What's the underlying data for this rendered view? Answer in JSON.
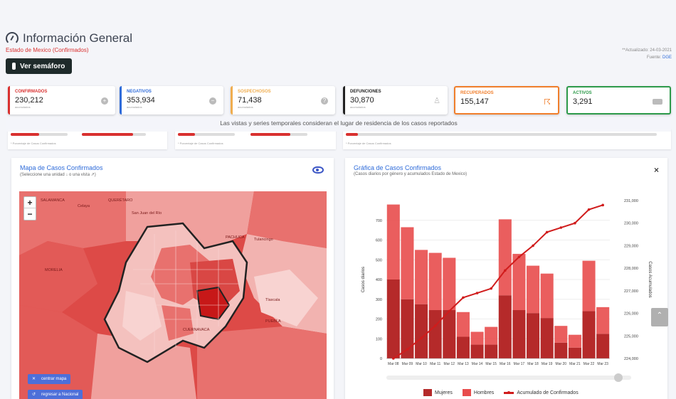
{
  "header": {
    "title": "Información General",
    "subtitle": "Estado de Mexico (Confirmados)",
    "semaforo_button": "Ver semáforo",
    "updated": "**Actualizado: 24-03-2021",
    "source_label": "Fuente:",
    "source": "DGE"
  },
  "cards": [
    {
      "label": "Confirmados",
      "value": "230,212",
      "sub": "acumulados",
      "color": "#d9302f",
      "icon": "plus-circle-icon"
    },
    {
      "label": "Negativos",
      "value": "353,934",
      "sub": "acumulados",
      "color": "#2e6bd9",
      "icon": "minus-circle-icon"
    },
    {
      "label": "Sospechosos",
      "value": "71,438",
      "sub": "acumulados",
      "color": "#f0ad4e",
      "icon": "question-circle-icon"
    },
    {
      "label": "Defunciones",
      "value": "30,870",
      "sub": "acumulados",
      "color": "#222222",
      "icon": "person-icon"
    },
    {
      "label": "Recuperados",
      "value": "155,147",
      "sub": "",
      "color": "#f07e2b",
      "icon": "walking-icon"
    },
    {
      "label": "Activos",
      "value": "3,291",
      "sub": "",
      "color": "#2d9a4a",
      "icon": "bed-icon"
    }
  ],
  "note": "Las vistas y series temporales consideran el lugar de residencia de los casos reportados",
  "strips": {
    "foot1": "* Porcentaje de Casos Confirmados",
    "foot2": "* Porcentaje de Casos Confirmados",
    "foot3": "* Porcentaje de Casos Confirmados"
  },
  "map_panel": {
    "title": "Mapa de Casos Confirmados",
    "subtitle": "(Seleccione una unidad ↓ o una vista ↗)",
    "zoom_in": "+",
    "zoom_out": "−",
    "btn_center": "centrar mapa",
    "btn_national": "regresar a Nacional",
    "labels": {
      "salamanca": "SALAMANCA",
      "queretaro": "QUERÉTARO",
      "celaya": "Celaya",
      "sanjuan": "San Juan del Río",
      "pachuca": "PACHUCA",
      "tulancingo": "Tulancingo",
      "morelia": "MORELIA",
      "tlaxcala": "Tlaxcala",
      "puebla": "PUEBLA",
      "cuernavaca": "CUERNAVACA"
    }
  },
  "chart_panel": {
    "title": "Gráfica de Casos Confirmados",
    "subtitle": "(Casos diarios por género y acumulados Estado de Mexico)",
    "close": "×",
    "legend": {
      "women": "Mujeres",
      "men": "Hombres",
      "cum": "Acumulado de Confirmados"
    }
  },
  "chart_data": {
    "type": "bar",
    "categories": [
      "Mar 08",
      "Mar 09",
      "Mar 10",
      "Mar 11",
      "Mar 12",
      "Mar 13",
      "Mar 14",
      "Mar 15",
      "Mar 16",
      "Mar 17",
      "Mar 18",
      "Mar 19",
      "Mar 20",
      "Mar 21",
      "Mar 22",
      "Mar 23"
    ],
    "series": [
      {
        "name": "Mujeres",
        "values": [
          400,
          300,
          275,
          245,
          245,
          110,
          70,
          70,
          320,
          245,
          230,
          205,
          80,
          55,
          240,
          125
        ]
      },
      {
        "name": "Hombres",
        "values": [
          380,
          365,
          275,
          290,
          265,
          125,
          65,
          90,
          385,
          285,
          240,
          225,
          85,
          65,
          255,
          135
        ]
      },
      {
        "name": "Acumulado de Confirmados",
        "axis": "right",
        "values": [
          224000,
          224400,
          224900,
          225450,
          226100,
          226700,
          226900,
          227100,
          227900,
          228500,
          229000,
          229600,
          229800,
          230000,
          230600,
          230800
        ]
      }
    ],
    "ylabel": "Casos diarios",
    "y2label": "Casos Acumulados",
    "ylim": [
      0,
      800
    ],
    "yticks": [
      0,
      100,
      200,
      300,
      400,
      500,
      600,
      700
    ],
    "y2lim": [
      224000,
      231000
    ],
    "y2ticks": [
      224000,
      225000,
      226000,
      227000,
      228000,
      229000,
      230000,
      231000
    ],
    "colors": {
      "women": "#b52a2a",
      "men": "#e84c4c",
      "cum": "#d01c1c"
    }
  }
}
